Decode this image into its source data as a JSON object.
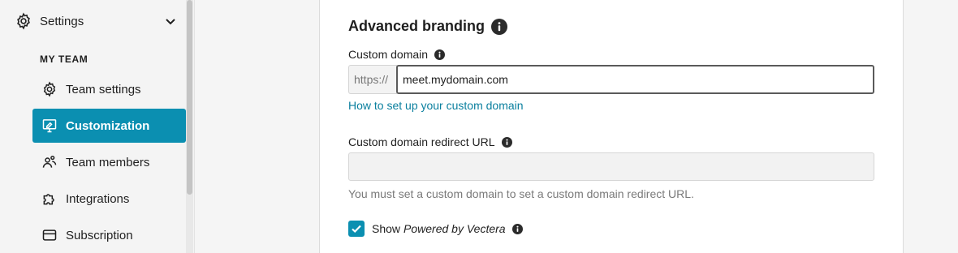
{
  "sidebar": {
    "settings_label": "Settings",
    "section_heading": "MY TEAM",
    "items": [
      {
        "label": "Team settings",
        "icon": "gear-icon",
        "active": false
      },
      {
        "label": "Customization",
        "icon": "monitor-brush-icon",
        "active": true
      },
      {
        "label": "Team members",
        "icon": "people-icon",
        "active": false
      },
      {
        "label": "Integrations",
        "icon": "puzzle-icon",
        "active": false
      },
      {
        "label": "Subscription",
        "icon": "credit-card-icon",
        "active": false
      }
    ]
  },
  "advanced_branding": {
    "title": "Advanced branding",
    "custom_domain": {
      "label": "Custom domain",
      "prefix": "https://",
      "value": "meet.mydomain.com",
      "help_link": "How to set up your custom domain"
    },
    "redirect": {
      "label": "Custom domain redirect URL",
      "value": "",
      "hint": "You must set a custom domain to set a custom domain redirect URL."
    },
    "powered_by": {
      "prefix": "Show",
      "brand_text": "Powered by Vectera",
      "checked": true
    }
  },
  "colors": {
    "accent": "#0b8fb1",
    "link": "#0a7f9e"
  }
}
